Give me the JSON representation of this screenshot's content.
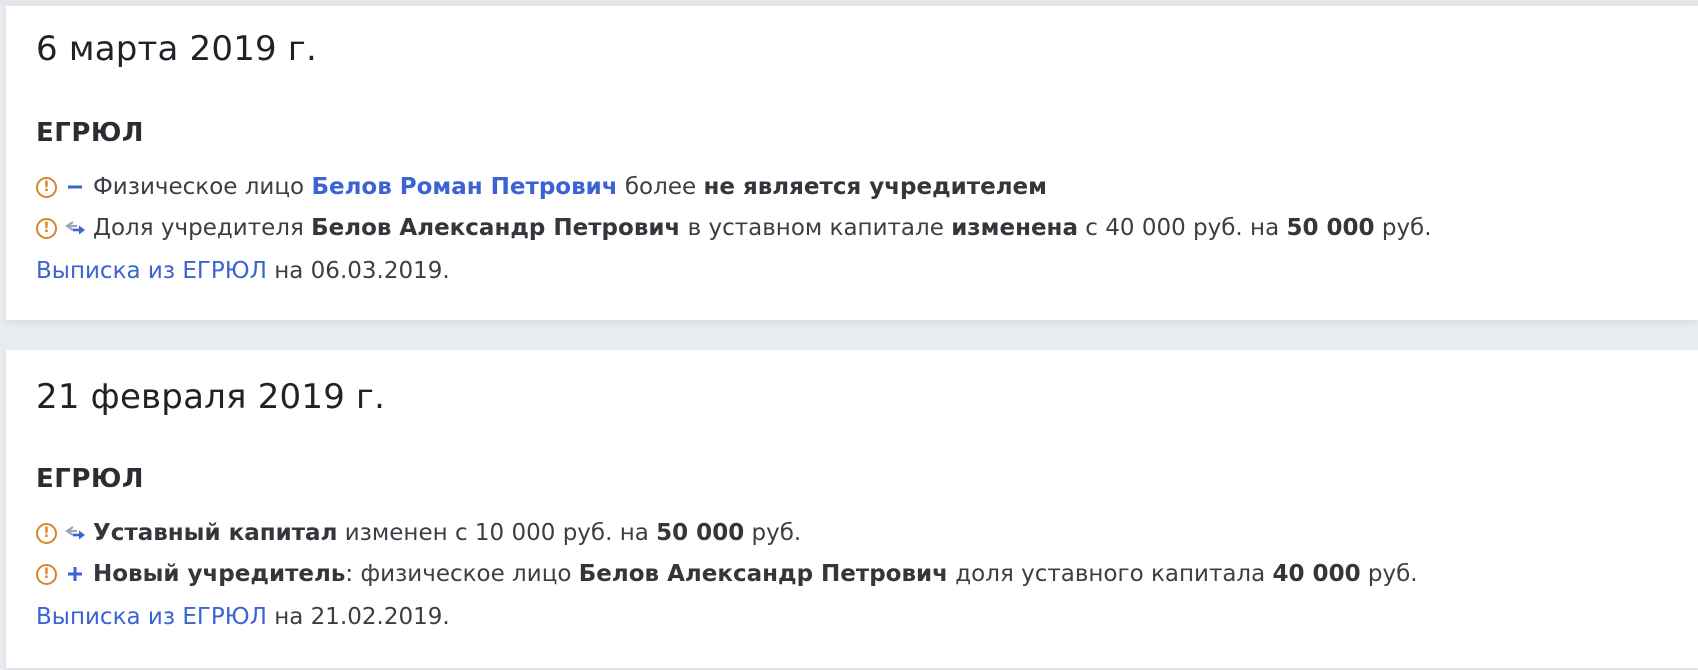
{
  "events": [
    {
      "date": "6 марта 2019 г.",
      "section": "ЕГРЮЛ",
      "row1": {
        "a": "Физическое лицо",
        "link": "Белов Роман Петрович",
        "b": "более",
        "strong": "не является учредителем"
      },
      "row2": {
        "a": "Доля учредителя",
        "name": "Белов Александр Петрович",
        "b": "в уставном капитале",
        "changed": "изменена",
        "c": "с 40 000 руб. на",
        "amount": "50 000",
        "d": "руб."
      },
      "extract": {
        "link": "Выписка из ЕГРЮЛ",
        "text": "на 06.03.2019."
      }
    },
    {
      "date": "21 февраля 2019 г.",
      "section": "ЕГРЮЛ",
      "row1": {
        "strong": "Уставный капитал",
        "a": "изменен с 10 000 руб. на",
        "amount": "50 000",
        "b": "руб."
      },
      "row2": {
        "strong": "Новый учредитель",
        "a": ": физическое лицо",
        "name": "Белов Александр Петрович",
        "b": "доля уставного капитала",
        "amount": "40 000",
        "c": "руб."
      },
      "extract": {
        "link": "Выписка из ЕГРЮЛ",
        "text": "на 21.02.2019."
      }
    }
  ],
  "icons": {
    "warning_glyph": "!",
    "warning_color": "#d6862a",
    "link_color": "#3b63d4",
    "op_color": "#3b63d4"
  }
}
